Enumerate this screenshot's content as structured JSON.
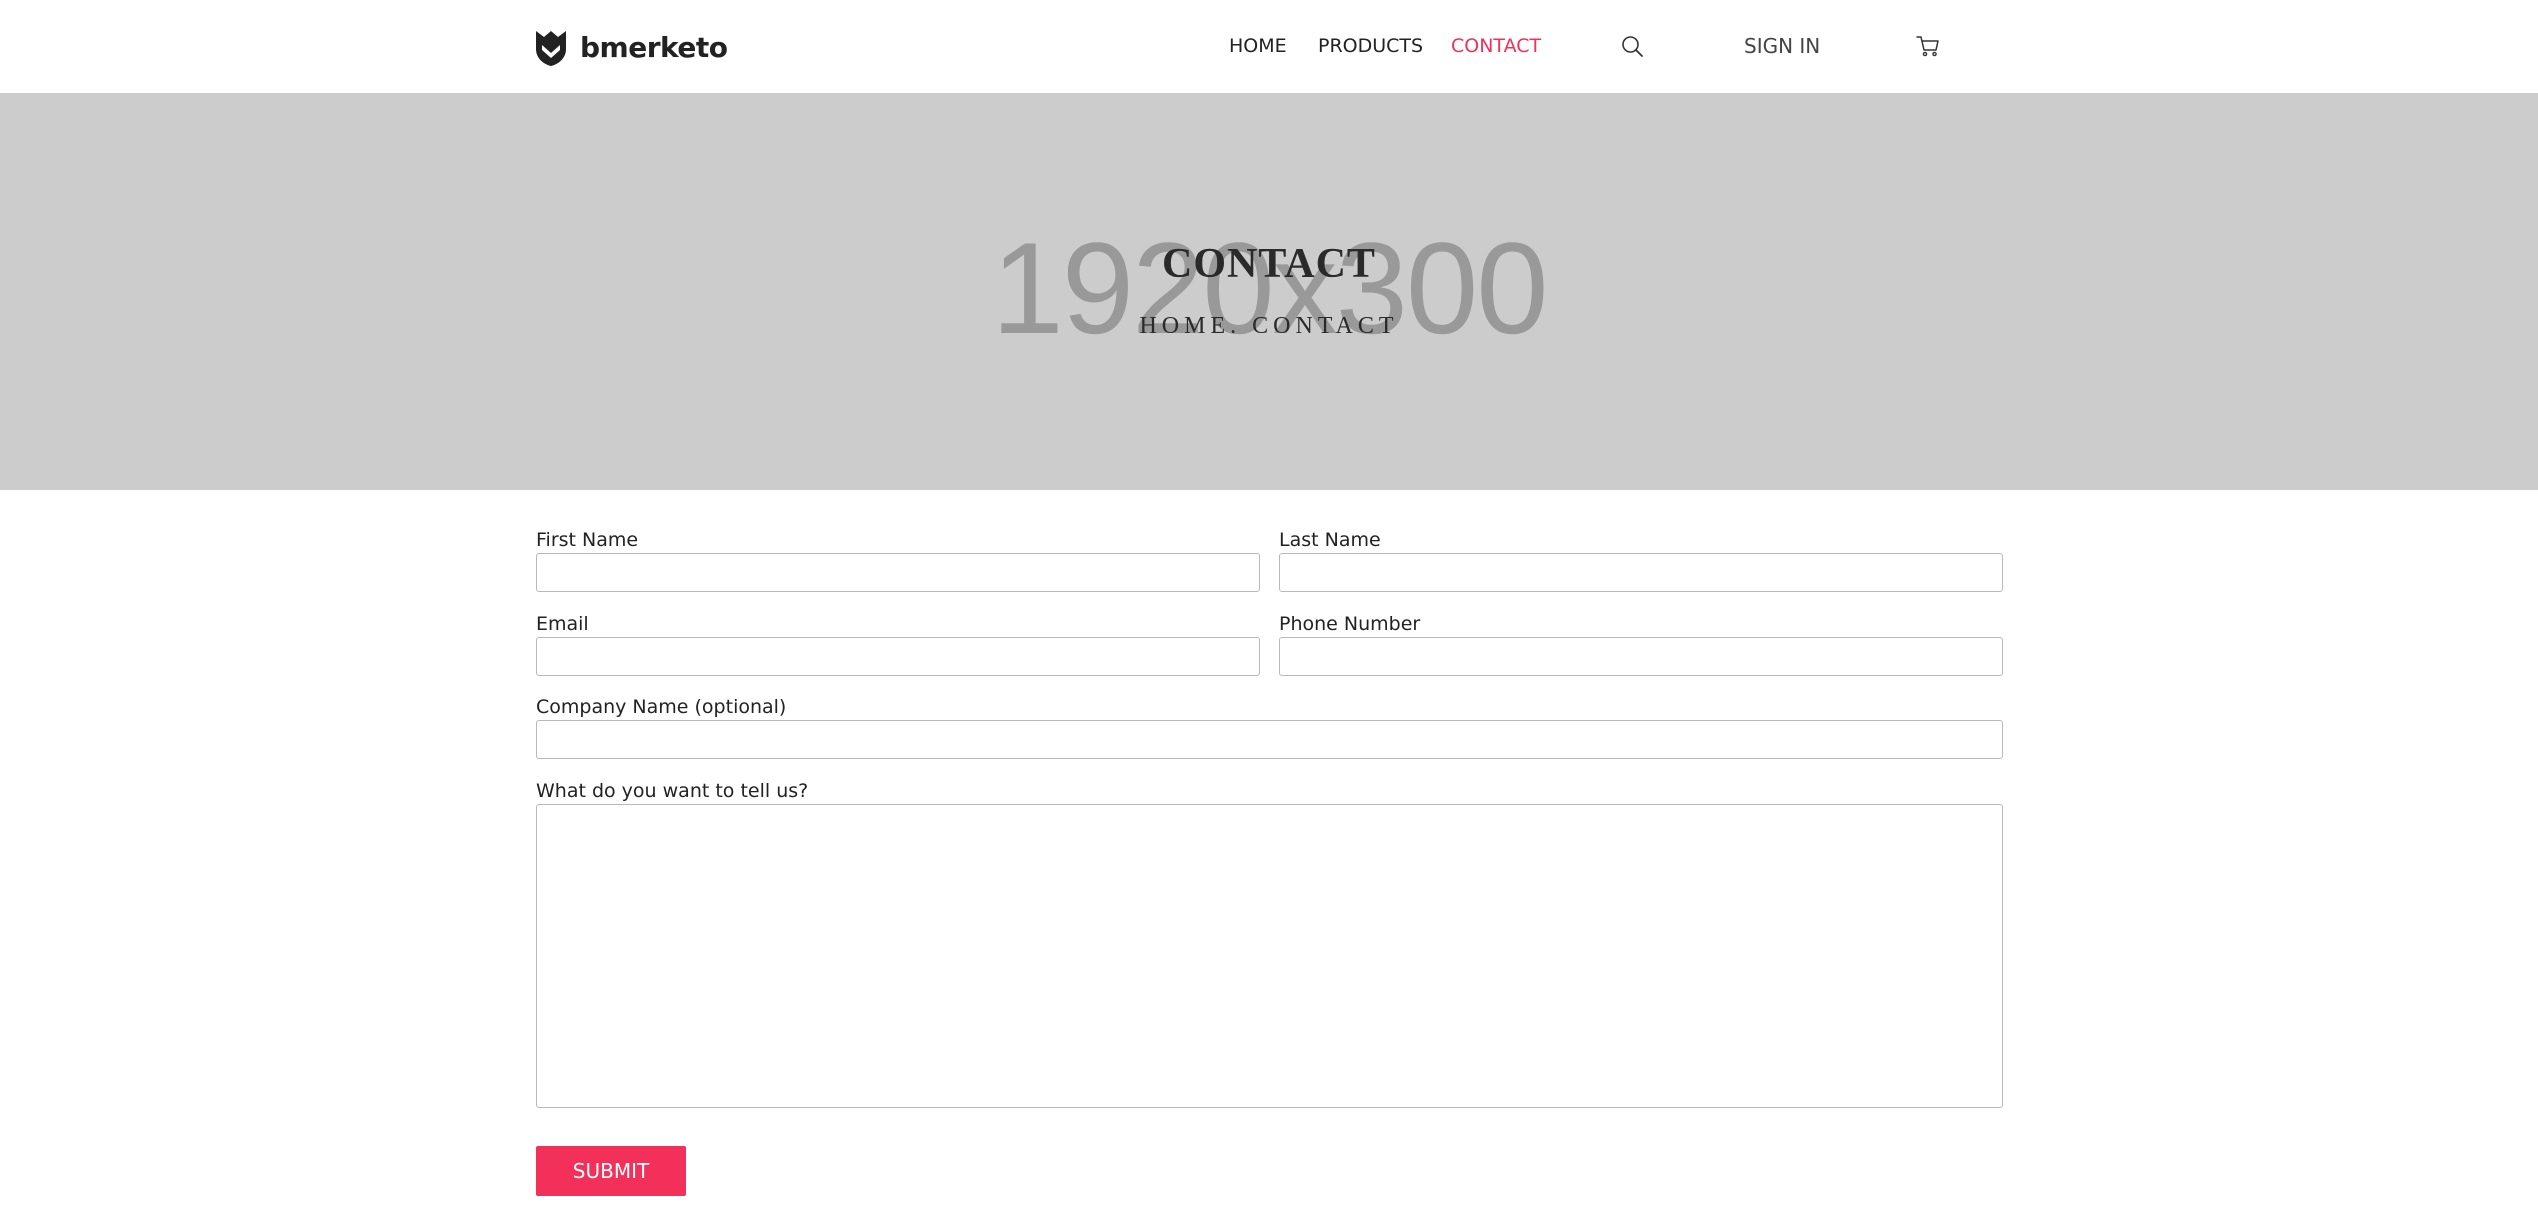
{
  "header": {
    "brand_name": "bmerketo",
    "nav": {
      "home": "HOME",
      "products": "PRODUCTS",
      "contact": "CONTACT"
    },
    "search_icon": "search-icon",
    "signin_label": "SIGN IN",
    "cart_icon": "cart-icon",
    "active_color": "#f2305a"
  },
  "hero": {
    "placeholder": "1920x300",
    "title": "CONTACT",
    "breadcrumb": "HOME. CONTACT",
    "background_color": "#cccccc"
  },
  "form": {
    "first_name": {
      "label": "First Name",
      "value": ""
    },
    "last_name": {
      "label": "Last Name",
      "value": ""
    },
    "email": {
      "label": "Email",
      "value": ""
    },
    "phone": {
      "label": "Phone Number",
      "value": ""
    },
    "company": {
      "label": "Company Name (optional)",
      "value": ""
    },
    "message": {
      "label": "What do you want to tell us?",
      "value": ""
    },
    "submit_label": "SUBMIT",
    "submit_color": "#f2305a"
  }
}
